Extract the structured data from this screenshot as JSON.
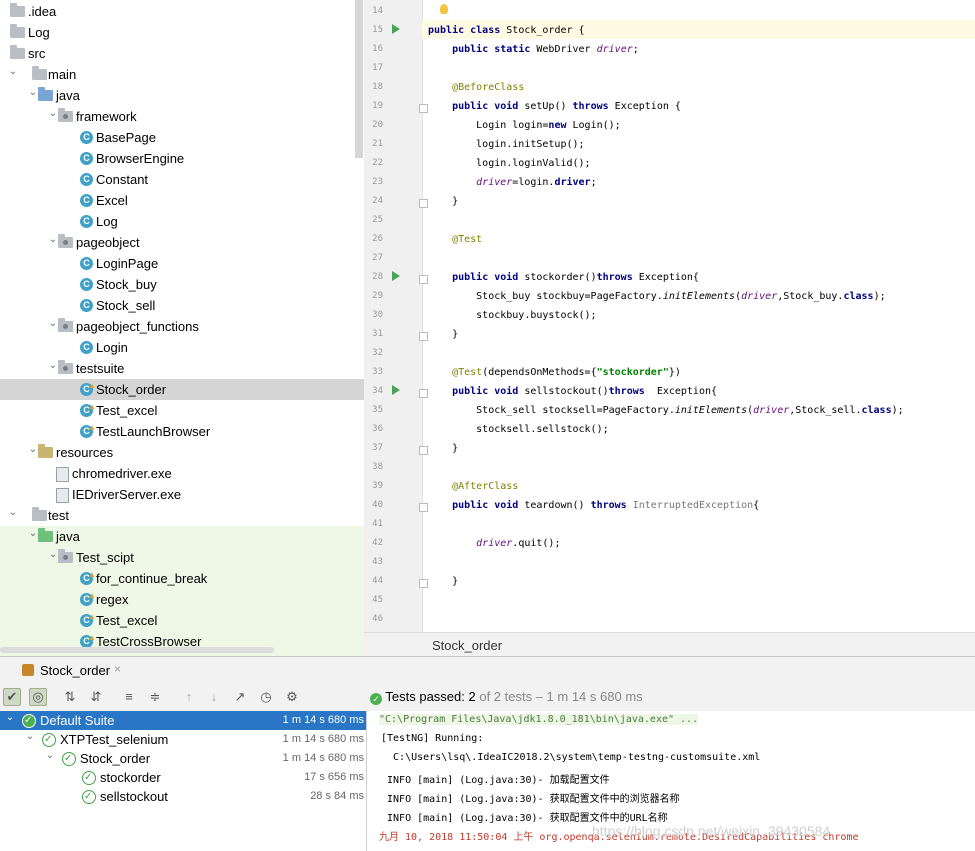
{
  "project_tree": {
    "items": [
      {
        "label": ".idea",
        "type": "folder",
        "depth": 0,
        "expanded": null
      },
      {
        "label": "Log",
        "type": "folder",
        "depth": 0,
        "expanded": null
      },
      {
        "label": "src",
        "type": "folder",
        "depth": 0,
        "expanded": null
      },
      {
        "label": "main",
        "type": "folder",
        "depth": 0,
        "expanded": true
      },
      {
        "label": "java",
        "type": "source-folder",
        "depth": 1,
        "expanded": true
      },
      {
        "label": "framework",
        "type": "package",
        "depth": 2,
        "expanded": true
      },
      {
        "label": "BasePage",
        "type": "class",
        "depth": 3
      },
      {
        "label": "BrowserEngine",
        "type": "class",
        "depth": 3
      },
      {
        "label": "Constant",
        "type": "class",
        "depth": 3
      },
      {
        "label": "Excel",
        "type": "class",
        "depth": 3
      },
      {
        "label": "Log",
        "type": "class",
        "depth": 3
      },
      {
        "label": "pageobject",
        "type": "package",
        "depth": 2,
        "expanded": true
      },
      {
        "label": "LoginPage",
        "type": "class",
        "depth": 3
      },
      {
        "label": "Stock_buy",
        "type": "class",
        "depth": 3
      },
      {
        "label": "Stock_sell",
        "type": "class",
        "depth": 3
      },
      {
        "label": "pageobject_functions",
        "type": "package",
        "depth": 2,
        "expanded": true
      },
      {
        "label": "Login",
        "type": "class",
        "depth": 3
      },
      {
        "label": "testsuite",
        "type": "package",
        "depth": 2,
        "expanded": true
      },
      {
        "label": "Stock_order",
        "type": "test-class",
        "depth": 3,
        "selected": true
      },
      {
        "label": "Test_excel",
        "type": "test-class",
        "depth": 3
      },
      {
        "label": "TestLaunchBrowser",
        "type": "test-class",
        "depth": 3
      },
      {
        "label": "resources",
        "type": "resource-folder",
        "depth": 1,
        "expanded": true
      },
      {
        "label": "chromedriver.exe",
        "type": "file",
        "depth": 2
      },
      {
        "label": "IEDriverServer.exe",
        "type": "file",
        "depth": 2
      },
      {
        "label": "test",
        "type": "folder",
        "depth": 0,
        "expanded": true
      },
      {
        "label": "java",
        "type": "test-folder",
        "depth": 1,
        "expanded": true
      },
      {
        "label": "Test_scipt",
        "type": "package",
        "depth": 2,
        "expanded": true
      },
      {
        "label": "for_continue_break",
        "type": "test-class",
        "depth": 3
      },
      {
        "label": "regex",
        "type": "test-class",
        "depth": 3
      },
      {
        "label": "Test_excel",
        "type": "test-class",
        "depth": 3
      },
      {
        "label": "TestCrossBrowser",
        "type": "test-class",
        "depth": 3
      }
    ]
  },
  "editor": {
    "file_tab": "Stock_order",
    "line_numbers": [
      "14",
      "15",
      "16",
      "17",
      "18",
      "19",
      "20",
      "21",
      "22",
      "23",
      "24",
      "25",
      "26",
      "27",
      "28",
      "29",
      "30",
      "31",
      "32",
      "33",
      "34",
      "35",
      "36",
      "37",
      "38",
      "39",
      "40",
      "41",
      "42",
      "43",
      "44",
      "45",
      "46"
    ],
    "run_gutter_lines": [
      "15",
      "28",
      "34"
    ],
    "fold_lines": [
      "19",
      "24",
      "28",
      "31",
      "34",
      "37",
      "40",
      "44"
    ],
    "lines": [
      [],
      [
        [
          "kw",
          "public class "
        ],
        [
          "",
          "Stock_order {"
        ]
      ],
      [
        [
          "",
          "    "
        ],
        [
          "kw",
          "public static "
        ],
        [
          "",
          "WebDriver "
        ],
        [
          "fi",
          "driver"
        ],
        [
          "",
          ";"
        ]
      ],
      [],
      [
        [
          "",
          "    "
        ],
        [
          "an",
          "@BeforeClass"
        ]
      ],
      [
        [
          "",
          "    "
        ],
        [
          "kw",
          "public void "
        ],
        [
          "",
          "setUp() "
        ],
        [
          "kw",
          "throws "
        ],
        [
          "",
          "Exception {"
        ]
      ],
      [
        [
          "",
          "        Login login="
        ],
        [
          "kw",
          "new "
        ],
        [
          "",
          "Login();"
        ]
      ],
      [
        [
          "",
          "        login.initSetup();"
        ]
      ],
      [
        [
          "",
          "        login.loginValid();"
        ]
      ],
      [
        [
          "",
          "        "
        ],
        [
          "fi",
          "driver"
        ],
        [
          "",
          "=login."
        ],
        [
          "kw",
          "driver"
        ],
        [
          "",
          ";"
        ]
      ],
      [
        [
          "",
          "    }"
        ]
      ],
      [],
      [
        [
          "",
          "    "
        ],
        [
          "an",
          "@Test"
        ]
      ],
      [],
      [
        [
          "",
          "    "
        ],
        [
          "kw",
          "public void "
        ],
        [
          "",
          "stockorder()"
        ],
        [
          "kw",
          "throws "
        ],
        [
          "",
          "Exception{"
        ]
      ],
      [
        [
          "",
          "        Stock_buy stockbuy=PageFactory."
        ],
        [
          "it",
          "initElements"
        ],
        [
          "",
          "("
        ],
        [
          "fi",
          "driver"
        ],
        [
          "",
          ",Stock_buy."
        ],
        [
          "kw",
          "class"
        ],
        [
          "",
          ");"
        ]
      ],
      [
        [
          "",
          "        stockbuy.buystock();"
        ]
      ],
      [
        [
          "",
          "    }"
        ]
      ],
      [],
      [
        [
          "",
          "    "
        ],
        [
          "an",
          "@Test"
        ],
        [
          "",
          "(dependsOnMethods={"
        ],
        [
          "st",
          "\"stockorder\""
        ],
        [
          "",
          "})"
        ]
      ],
      [
        [
          "",
          "    "
        ],
        [
          "kw",
          "public void "
        ],
        [
          "",
          "sellstockout()"
        ],
        [
          "kw",
          "throws  "
        ],
        [
          "",
          "Exception{"
        ]
      ],
      [
        [
          "",
          "        Stock_sell stocksell=PageFactory."
        ],
        [
          "it",
          "initElements"
        ],
        [
          "",
          "("
        ],
        [
          "fi",
          "driver"
        ],
        [
          "",
          ",Stock_sell."
        ],
        [
          "kw",
          "class"
        ],
        [
          "",
          ");"
        ]
      ],
      [
        [
          "",
          "        stocksell.sellstock();"
        ]
      ],
      [
        [
          "",
          "    }"
        ]
      ],
      [],
      [
        [
          "",
          "    "
        ],
        [
          "an",
          "@AfterClass"
        ]
      ],
      [
        [
          "",
          "    "
        ],
        [
          "kw",
          "public void "
        ],
        [
          "",
          "teardown() "
        ],
        [
          "kw",
          "throws "
        ],
        [
          "gr",
          "InterruptedException"
        ],
        [
          "",
          "{"
        ]
      ],
      [],
      [
        [
          "",
          "        "
        ],
        [
          "fi",
          "driver"
        ],
        [
          "",
          ".quit();"
        ]
      ],
      [],
      [
        [
          "",
          "    }"
        ]
      ],
      [],
      []
    ]
  },
  "run_panel": {
    "tab_label": "Stock_order",
    "tab_close": "×",
    "status_prefix": "Tests passed: ",
    "status_count": "2",
    "status_suffix": " of 2 tests – 1 m 14 s 680 ms",
    "toolbar_icons": [
      "run-ok-icon",
      "show-ignored-icon",
      "sort-alpha-icon",
      "sort-duration-icon",
      "expand-all-icon",
      "collapse-all-icon",
      "prev-fail-icon",
      "next-fail-icon",
      "export-icon",
      "history-icon",
      "settings-icon"
    ],
    "results": [
      {
        "label": "Default Suite",
        "time": "1 m 14 s 680 ms",
        "depth": 0,
        "selected": true
      },
      {
        "label": "XTPTest_selenium",
        "time": "1 m 14 s 680 ms",
        "depth": 1
      },
      {
        "label": "Stock_order",
        "time": "1 m 14 s 680 ms",
        "depth": 2
      },
      {
        "label": "stockorder",
        "time": "17 s 656 ms",
        "depth": 3
      },
      {
        "label": "sellstockout",
        "time": "28 s 84 ms",
        "depth": 3
      }
    ],
    "console": [
      {
        "text": "\"C:\\Program Files\\Java\\jdk1.8.0_181\\bin\\java.exe\" ...",
        "style": "cmd"
      },
      {
        "text": "[TestNG] Running:",
        "style": ""
      },
      {
        "text": "  C:\\Users\\lsq\\.IdeaIC2018.2\\system\\temp-testng-customsuite.xml",
        "style": ""
      },
      {
        "text": " INFO [main] (Log.java:30)- 加载配置文件",
        "style": ""
      },
      {
        "text": " INFO [main] (Log.java:30)- 获取配置文件中的浏览器名称",
        "style": ""
      },
      {
        "text": " INFO [main] (Log.java:30)- 获取配置文件中的URL名称",
        "style": ""
      },
      {
        "text": "九月 10, 2018 11:50:04 上午 org.openqa.selenium.remote.DesiredCapabilities chrome",
        "style": "red"
      }
    ],
    "watermark": "https://blog.csdn.net/weixin_39430584"
  }
}
